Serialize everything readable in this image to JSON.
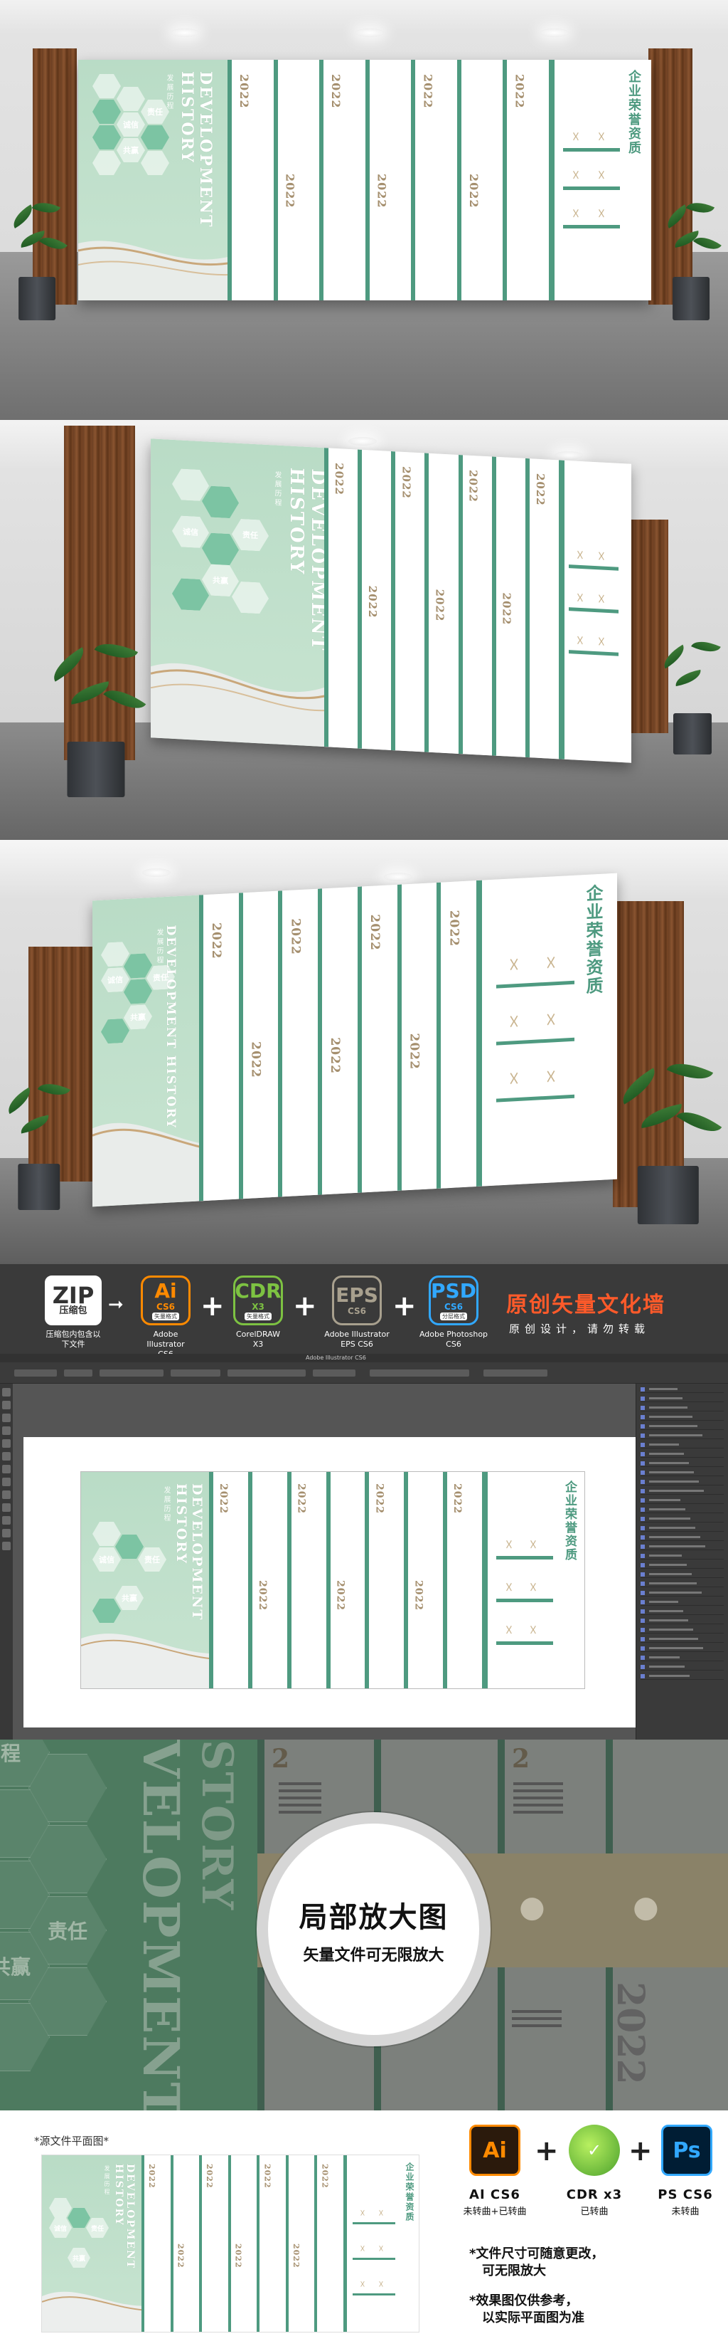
{
  "wall": {
    "title_en": "DEVELOPMENT HISTORY",
    "subtitle_cn": "发展历程",
    "hex_words": [
      "诚信",
      "责任",
      "共赢"
    ],
    "year": "2022",
    "honor_title": "企业荣誉资质"
  },
  "formats": {
    "zip": {
      "name": "ZIP",
      "ver": "压缩包",
      "cap": "压缩包内包含以下文件"
    },
    "ai": {
      "name": "Ai",
      "ver": "CS6",
      "tag": "矢量格式",
      "cap1": "Adobe Illustrator",
      "cap2": "CS6"
    },
    "cdr": {
      "name": "CDR",
      "ver": "X3",
      "tag": "矢量格式",
      "cap1": "CorelDRAW",
      "cap2": "X3"
    },
    "eps": {
      "name": "EPS",
      "ver": "CS6",
      "cap1": "Adobe Illustrator",
      "cap2": "EPS CS6"
    },
    "psd": {
      "name": "PSD",
      "ver": "CS6",
      "tag": "分层格式",
      "cap1": "Adobe Photoshop",
      "cap2": "CS6"
    }
  },
  "banner": {
    "title": "原创矢量文化墙",
    "subtitle": "原创设计，请勿转载"
  },
  "ai_window": {
    "doc_title": "Adobe Illustrator CS6"
  },
  "zoom": {
    "title": "局部放大图",
    "subtitle": "矢量文件可无限放大",
    "bg_title": "VELOPMENT",
    "bg_title2": "STORY",
    "year_top": "2",
    "year_bottom": "2022",
    "hex_words": [
      "程",
      "责任",
      "共赢"
    ]
  },
  "bottom": {
    "source_label": "*源文件平面图*",
    "software": [
      {
        "name": "Ai",
        "title": "AI CS6",
        "note": "未转曲+已转曲"
      },
      {
        "name": "CDR",
        "title": "CDR x3",
        "note": "已转曲"
      },
      {
        "name": "Ps",
        "title": "PS CS6",
        "note": "未转曲"
      }
    ],
    "note1_line1": "*文件尺寸可随意更改，",
    "note1_line2": "可无限放大",
    "note2_line1": "*效果图仅供参考，",
    "note2_line2": "以实际平面图为准"
  },
  "colors": {
    "accent": "#4e9a80",
    "band": "#d4c7a9",
    "banner_title": "#ff5a2a"
  }
}
